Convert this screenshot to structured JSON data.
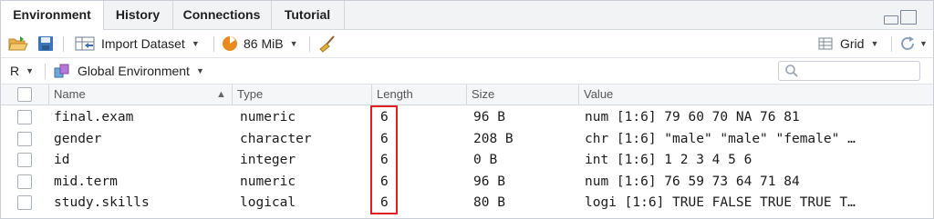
{
  "tabs": [
    "Environment",
    "History",
    "Connections",
    "Tutorial"
  ],
  "toolbar": {
    "import_label": "Import Dataset",
    "memory_label": "86 MiB",
    "grid_label": "Grid"
  },
  "env": {
    "language": "R",
    "scope": "Global Environment",
    "search_placeholder": ""
  },
  "table": {
    "columns": [
      "Name",
      "Type",
      "Length",
      "Size",
      "Value"
    ],
    "rows": [
      {
        "name": "final.exam",
        "type": "numeric",
        "length": "6",
        "size": "96 B",
        "value": "num [1:6] 79 60 70 NA 76 81"
      },
      {
        "name": "gender",
        "type": "character",
        "length": "6",
        "size": "208 B",
        "value": "chr [1:6] \"male\" \"male\" \"female\" …"
      },
      {
        "name": "id",
        "type": "integer",
        "length": "6",
        "size": "0 B",
        "value": "int [1:6] 1 2 3 4 5 6"
      },
      {
        "name": "mid.term",
        "type": "numeric",
        "length": "6",
        "size": "96 B",
        "value": "num [1:6] 76 59 73 64 71 84"
      },
      {
        "name": "study.skills",
        "type": "logical",
        "length": "6",
        "size": "80 B",
        "value": "logi [1:6] TRUE FALSE TRUE TRUE T…"
      }
    ]
  },
  "colors": {
    "highlight": "#e02020",
    "accent": "#3a6ea5"
  }
}
